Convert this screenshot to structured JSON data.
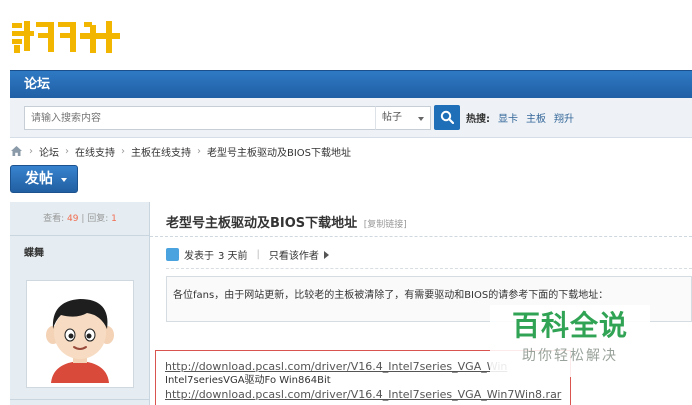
{
  "logo": {
    "text": "翔升",
    "color": "#f2b600"
  },
  "nav": {
    "tab_label": "论坛",
    "bar_color": "#1f5fa4"
  },
  "search": {
    "placeholder": "请输入搜索内容",
    "scope_value": "帖子",
    "hot_label": "热搜:",
    "hot_links": [
      "显卡",
      "主板",
      "翔升"
    ]
  },
  "breadcrumb": [
    "论坛",
    "在线支持",
    "主板在线支持",
    "老型号主板驱动及BIOS下载地址"
  ],
  "post_button": {
    "label": "发帖"
  },
  "sidebar": {
    "views_label": "查看:",
    "views": "49",
    "divider": "|",
    "replies_label": "回复:",
    "replies": "1",
    "author": "蝶舞"
  },
  "thread": {
    "title": "老型号主板驱动及BIOS下载地址",
    "copy_link": "[复制链接]",
    "posted_prefix": "发表于",
    "posted_time": "3 天前",
    "separator": "|",
    "only_author": "只看该作者",
    "body": "各位fans，由于网站更新，比较老的主板被清除了，有需要驱动和BIOS的请参考下面的下载地址：",
    "links": [
      {
        "url": "http://download.pcasl.com/driver/V16.4_Intel7series_VGA_Win",
        "caption": "Intel7seriesVGA驱动Fo Win864Bit"
      },
      {
        "url": "http://download.pcasl.com/driver/V16.4_Intel7series_VGA_Win7Win8.rar",
        "caption": ""
      }
    ]
  },
  "watermark": {
    "main": "百科全说",
    "sub": "助你轻松解决",
    "color": "#31a354"
  },
  "colors": {
    "accent": "#1f6fb8",
    "count": "#f26c4f",
    "link_border": "#d9534f"
  }
}
